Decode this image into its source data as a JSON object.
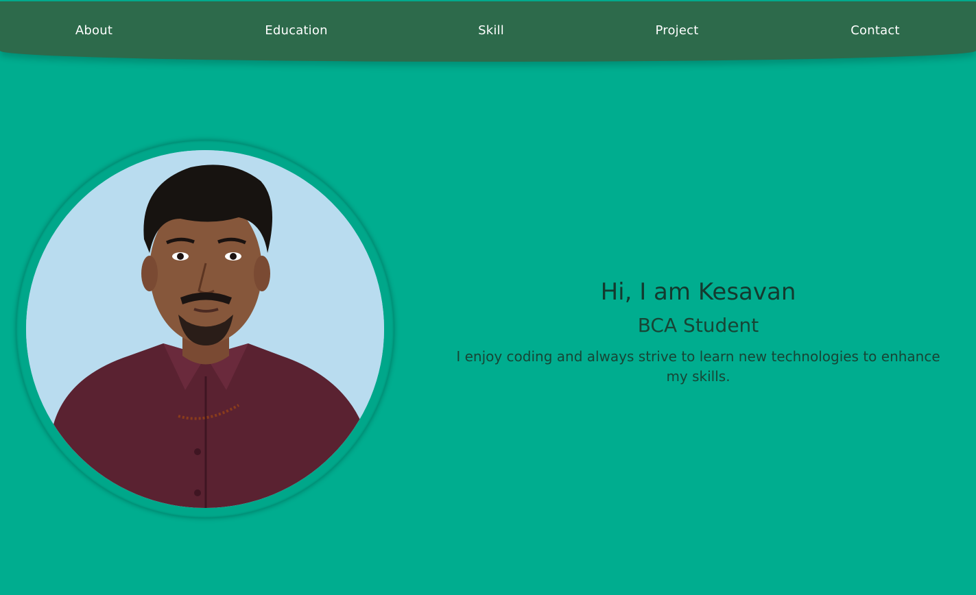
{
  "nav": {
    "about": "About",
    "education": "Education",
    "skill": "Skill",
    "project": "Project",
    "contact": "Contact"
  },
  "hero": {
    "greeting": "Hi, I am Kesavan",
    "role": "BCA Student",
    "tagline": "I enjoy coding and always strive to learn new technologies to enhance my skills."
  },
  "colors": {
    "background": "#00ad8f",
    "navbar": "#2d6a4b",
    "nav_text": "#ffffff",
    "heading_text": "#143a2f",
    "photo_background": "#b9dcef"
  }
}
